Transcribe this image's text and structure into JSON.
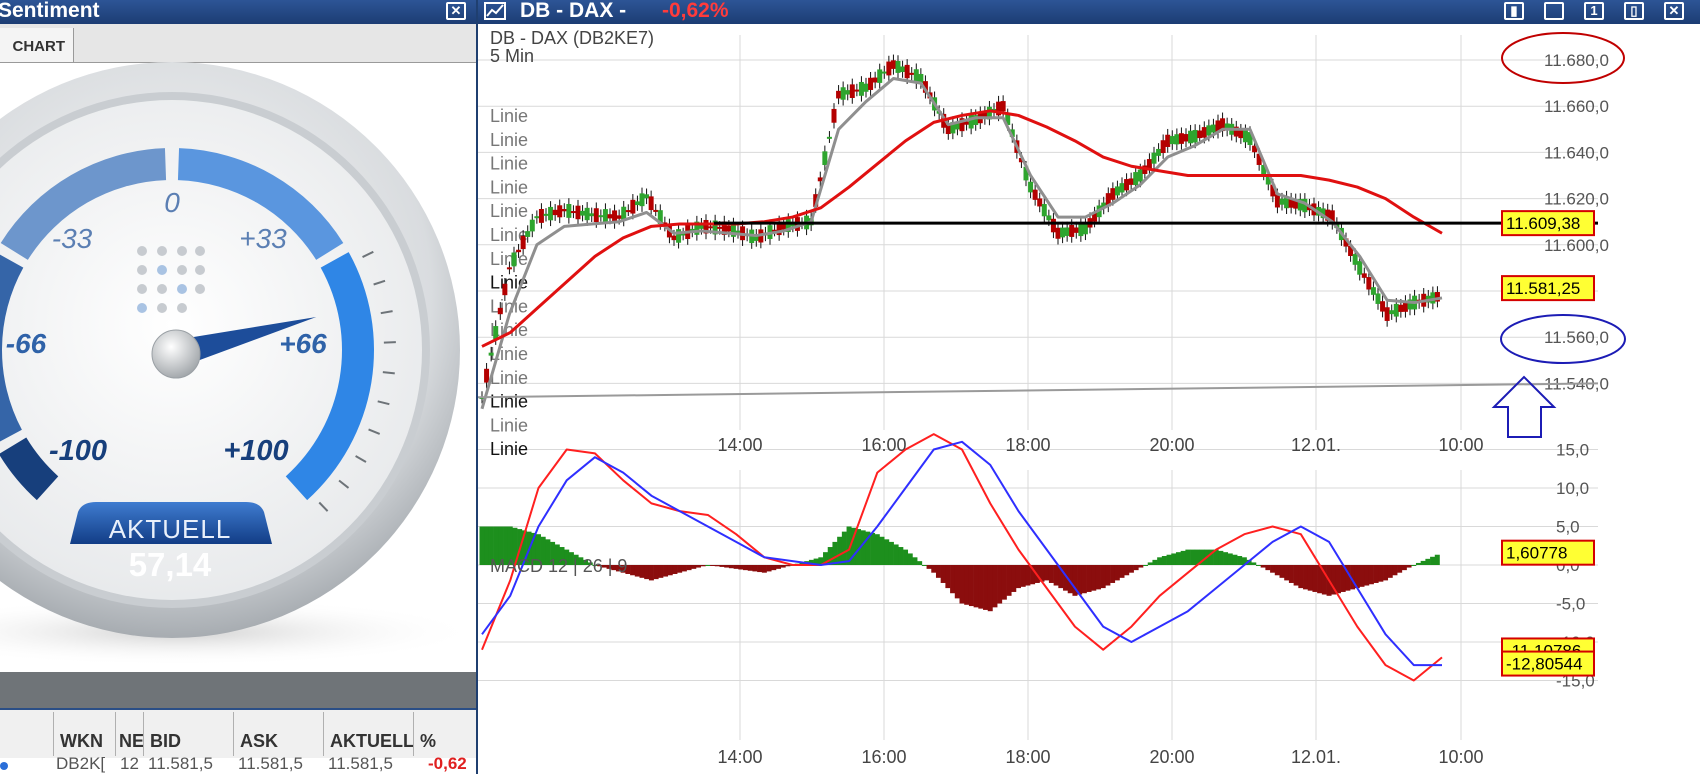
{
  "left_panel": {
    "title": "Sentiment",
    "tab": "CHART",
    "gauge": {
      "labels": [
        "0",
        "-33",
        "+33",
        "-66",
        "+66",
        "-100",
        "+100"
      ],
      "aktuell_label": "AKTUELL",
      "aktuell_value": "57,14",
      "needle_value": 57.14
    },
    "table": {
      "headers": [
        "WKN",
        "NE",
        "BID",
        "ASK",
        "AKTUELL",
        "%"
      ],
      "row": [
        "DB2K[",
        "12",
        "11.581,5",
        "11.581,5",
        "11.581,5",
        "-0,62"
      ]
    }
  },
  "right_panel": {
    "title": "DB - DAX -",
    "change": "-0,62%",
    "chart_title": "DB - DAX (DB2KE7)",
    "interval": "5 Min",
    "linie_label": "Linie",
    "indicator_label": "MACD 12 | 26 | 9",
    "price_badges": [
      "11.609,38",
      "11.581,25"
    ],
    "macd_badges": [
      "1,60778",
      "-11,10786",
      "-12,80544"
    ]
  },
  "chart_data": [
    {
      "type": "line",
      "title": "DB - DAX (DB2KE7)",
      "subtitle": "5 Min",
      "x": [
        "14:00",
        "16:00",
        "18:00",
        "20:00",
        "12.01.",
        "10:00"
      ],
      "y_ticks": [
        "11.680,0",
        "11.660,0",
        "11.640,0",
        "11.620,0",
        "11.600,0",
        "11.560,0",
        "11.540,0"
      ],
      "ylim": [
        11530,
        11690
      ],
      "series": [
        {
          "values": [
            11534,
            11590,
            11612,
            11615,
            11613,
            11612,
            11621,
            11603,
            11608,
            11607,
            11603,
            11608,
            11610,
            11665,
            11668,
            11678,
            11672,
            11650,
            11654,
            11660,
            11625,
            11605,
            11607,
            11622,
            11630,
            11645,
            11647,
            11652,
            11646,
            11619,
            11617,
            11612,
            11590,
            11570,
            11575,
            11578
          ]
        },
        {
          "values": [
            11529,
            11570,
            11600,
            11608,
            11609,
            11610,
            11614,
            11605,
            11606,
            11605,
            11604,
            11606,
            11610,
            11650,
            11662,
            11672,
            11670,
            11652,
            11655,
            11655,
            11630,
            11612,
            11612,
            11618,
            11626,
            11638,
            11643,
            11650,
            11650,
            11622,
            11618,
            11610,
            11595,
            11576,
            11575,
            11577
          ]
        },
        {
          "values": [
            11556,
            11562,
            11573,
            11584,
            11595,
            11603,
            11608,
            11609,
            11609,
            11609,
            11610,
            11612,
            11616,
            11625,
            11635,
            11645,
            11653,
            11656,
            11658,
            11656,
            11651,
            11645,
            11638,
            11634,
            11632,
            11630,
            11630,
            11630,
            11630,
            11630,
            11628,
            11625,
            11620,
            11612,
            11605
          ]
        }
      ],
      "lines": [
        {
          "value": 11609.38
        },
        {
          "value": 11534,
          "to": 11540
        }
      ]
    },
    {
      "type": "line",
      "title": "MACD 12 | 26 | 9",
      "x": [
        "14:00",
        "16:00",
        "18:00",
        "20:00",
        "12.01.",
        "10:00"
      ],
      "y_ticks": [
        "15,0",
        "10,0",
        "5,0",
        "0,0",
        "-5,0",
        "-10,0",
        "-15,0"
      ],
      "ylim": [
        -16,
        18
      ],
      "series": [
        {
          "values": [
            -11,
            -2,
            10,
            15,
            14.5,
            11,
            8,
            7,
            6.5,
            4,
            1,
            0,
            0,
            2,
            12,
            15,
            17,
            15,
            8,
            2,
            -3,
            -8,
            -11,
            -8,
            -4,
            -1,
            2,
            4,
            5,
            4,
            -2,
            -8,
            -13,
            -15,
            -12
          ]
        },
        {
          "values": [
            -9,
            -4,
            5,
            11,
            14,
            12,
            9,
            7,
            5,
            3,
            1,
            0.5,
            0,
            0.5,
            5,
            10,
            15,
            16,
            13,
            7,
            2,
            -3,
            -8,
            -10,
            -8,
            -6,
            -3,
            0,
            3,
            5,
            3,
            -3,
            -9,
            -13,
            -13
          ]
        },
        {
          "values": [
            5,
            5,
            4,
            2,
            0,
            -1,
            -2,
            -1,
            0,
            -0.5,
            -1,
            0,
            1,
            5,
            4,
            2,
            -1,
            -5,
            -6,
            -3,
            -2,
            -4,
            -3,
            -1,
            1,
            2,
            2,
            1,
            -1,
            -3,
            -4,
            -3,
            -2,
            0,
            1.6
          ]
        }
      ],
      "badges": [
        1.60778,
        -11.10786,
        -12.80544
      ]
    }
  ],
  "colors": {
    "titlebar": "#1f4585",
    "change_red": "#ff3b3b",
    "candle_up": "#2ea52e",
    "candle_down": "#b40000",
    "ma_fast": "#8f8f8f",
    "ma_slow": "#e01010",
    "macd_line": "#ff2020",
    "signal_line": "#2f2fff",
    "hist_up": "#1d8f1d",
    "hist_down": "#8b0d0d",
    "badge_fill": "#ffff33",
    "badge_border": "#d40000",
    "annotation_red": "#c00000",
    "annotation_blue": "#1c1cb5"
  },
  "icons": [
    "close-icon",
    "chart-icon",
    "window-icon",
    "restore-icon",
    "new-window-icon",
    "copy-icon"
  ]
}
